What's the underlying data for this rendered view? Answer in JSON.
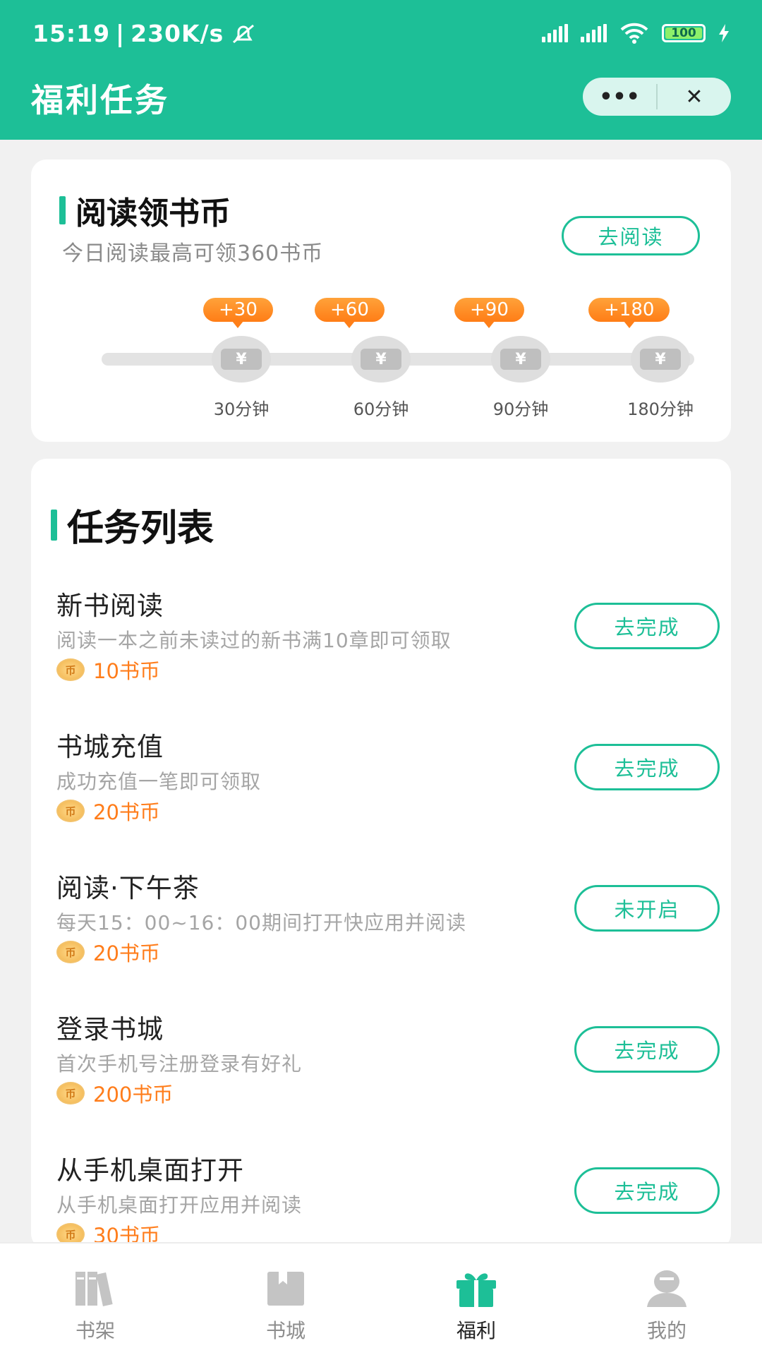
{
  "status_bar": {
    "time": "15:19",
    "speed": "230K/s",
    "battery": "100"
  },
  "header": {
    "title": "福利任务",
    "more_glyph": "•••",
    "close_glyph": "✕"
  },
  "reading": {
    "title": "阅读领书币",
    "subtitle": "今日阅读最高可领360书币",
    "button": "去阅读",
    "coin_symbol": "¥",
    "milestones": [
      {
        "reward": "+30",
        "minutes": "30分钟"
      },
      {
        "reward": "+60",
        "minutes": "60分钟"
      },
      {
        "reward": "+90",
        "minutes": "90分钟"
      },
      {
        "reward": "+180",
        "minutes": "180分钟"
      }
    ]
  },
  "tasks": {
    "title": "任务列表",
    "coin_icon_text": "币",
    "items": [
      {
        "name": "新书阅读",
        "desc": "阅读一本之前未读过的新书满10章即可领取",
        "reward": "10书币",
        "button": "去完成"
      },
      {
        "name": "书城充值",
        "desc": "成功充值一笔即可领取",
        "reward": "20书币",
        "button": "去完成"
      },
      {
        "name": "阅读·下午茶",
        "desc": "每天15：00~16：00期间打开快应用并阅读",
        "reward": "20书币",
        "button": "未开启"
      },
      {
        "name": "登录书城",
        "desc": "首次手机号注册登录有好礼",
        "reward": "200书币",
        "button": "去完成"
      },
      {
        "name": "从手机桌面打开",
        "desc": "从手机桌面打开应用并阅读",
        "reward": "30书币",
        "button": "去完成"
      }
    ]
  },
  "tabbar": {
    "items": [
      {
        "label": "书架",
        "icon": "bookshelf-icon"
      },
      {
        "label": "书城",
        "icon": "bookstore-icon"
      },
      {
        "label": "福利",
        "icon": "gift-icon"
      },
      {
        "label": "我的",
        "icon": "profile-icon"
      }
    ]
  },
  "colors": {
    "primary": "#1dbf97",
    "orange": "#ff7d16",
    "inactive": "#c4c4c4"
  }
}
